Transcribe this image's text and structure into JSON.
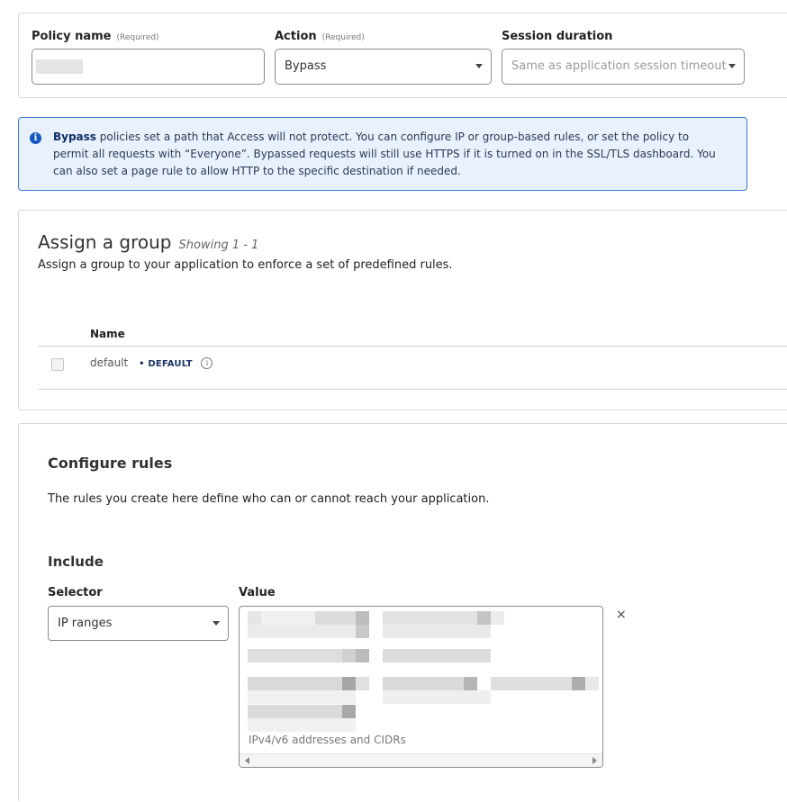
{
  "policy": {
    "name_label": "Policy name",
    "name_required": "(Required)",
    "action_label": "Action",
    "action_required": "(Required)",
    "action_value": "Bypass",
    "session_label": "Session duration",
    "session_placeholder": "Same as application session timeout"
  },
  "notice": {
    "bold": "Bypass",
    "text": " policies set a path that Access will not protect. You can configure IP or group-based rules, or set the policy to permit all requests with “Everyone”. Bypassed requests will still use HTTPS if it is turned on in the SSL/TLS dashboard. You can also set a page rule to allow HTTP to the specific destination if needed."
  },
  "groups": {
    "title": "Assign a group",
    "showing": "Showing 1 - 1",
    "description": "Assign a group to your application to enforce a set of predefined rules.",
    "column_name": "Name",
    "rows": [
      {
        "name": "default",
        "badge": "• DEFAULT"
      }
    ]
  },
  "rules": {
    "title": "Configure rules",
    "description": "The rules you create here define who can or cannot reach your application.",
    "include_title": "Include",
    "selector_label": "Selector",
    "value_label": "Value",
    "selector_value": "IP ranges",
    "value_placeholder": "IPv4/v6 addresses and CIDRs",
    "remove_symbol": "×"
  },
  "icons": {
    "info": "info-circle-icon",
    "caret": "chevron-down-icon",
    "close": "close-icon"
  }
}
